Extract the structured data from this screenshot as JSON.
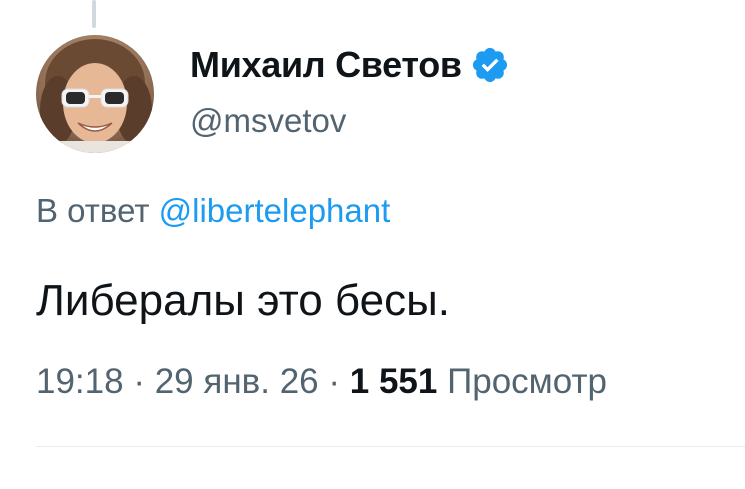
{
  "tweet": {
    "author": {
      "display_name": "Михаил Светов",
      "handle": "@msvetov",
      "verified_icon": "verified-badge-icon",
      "verified_color": "#1d9bf0"
    },
    "reply_to": {
      "prefix": "В ответ",
      "mention": "@libertelephant"
    },
    "text": "Либералы это бесы.",
    "time": "19:18",
    "separator": "·",
    "date": "29 янв. 26",
    "views_count": "1 551",
    "views_label": "Просмотр",
    "colors": {
      "text": "#0f1419",
      "secondary": "#536471",
      "link": "#1d9bf0"
    }
  }
}
